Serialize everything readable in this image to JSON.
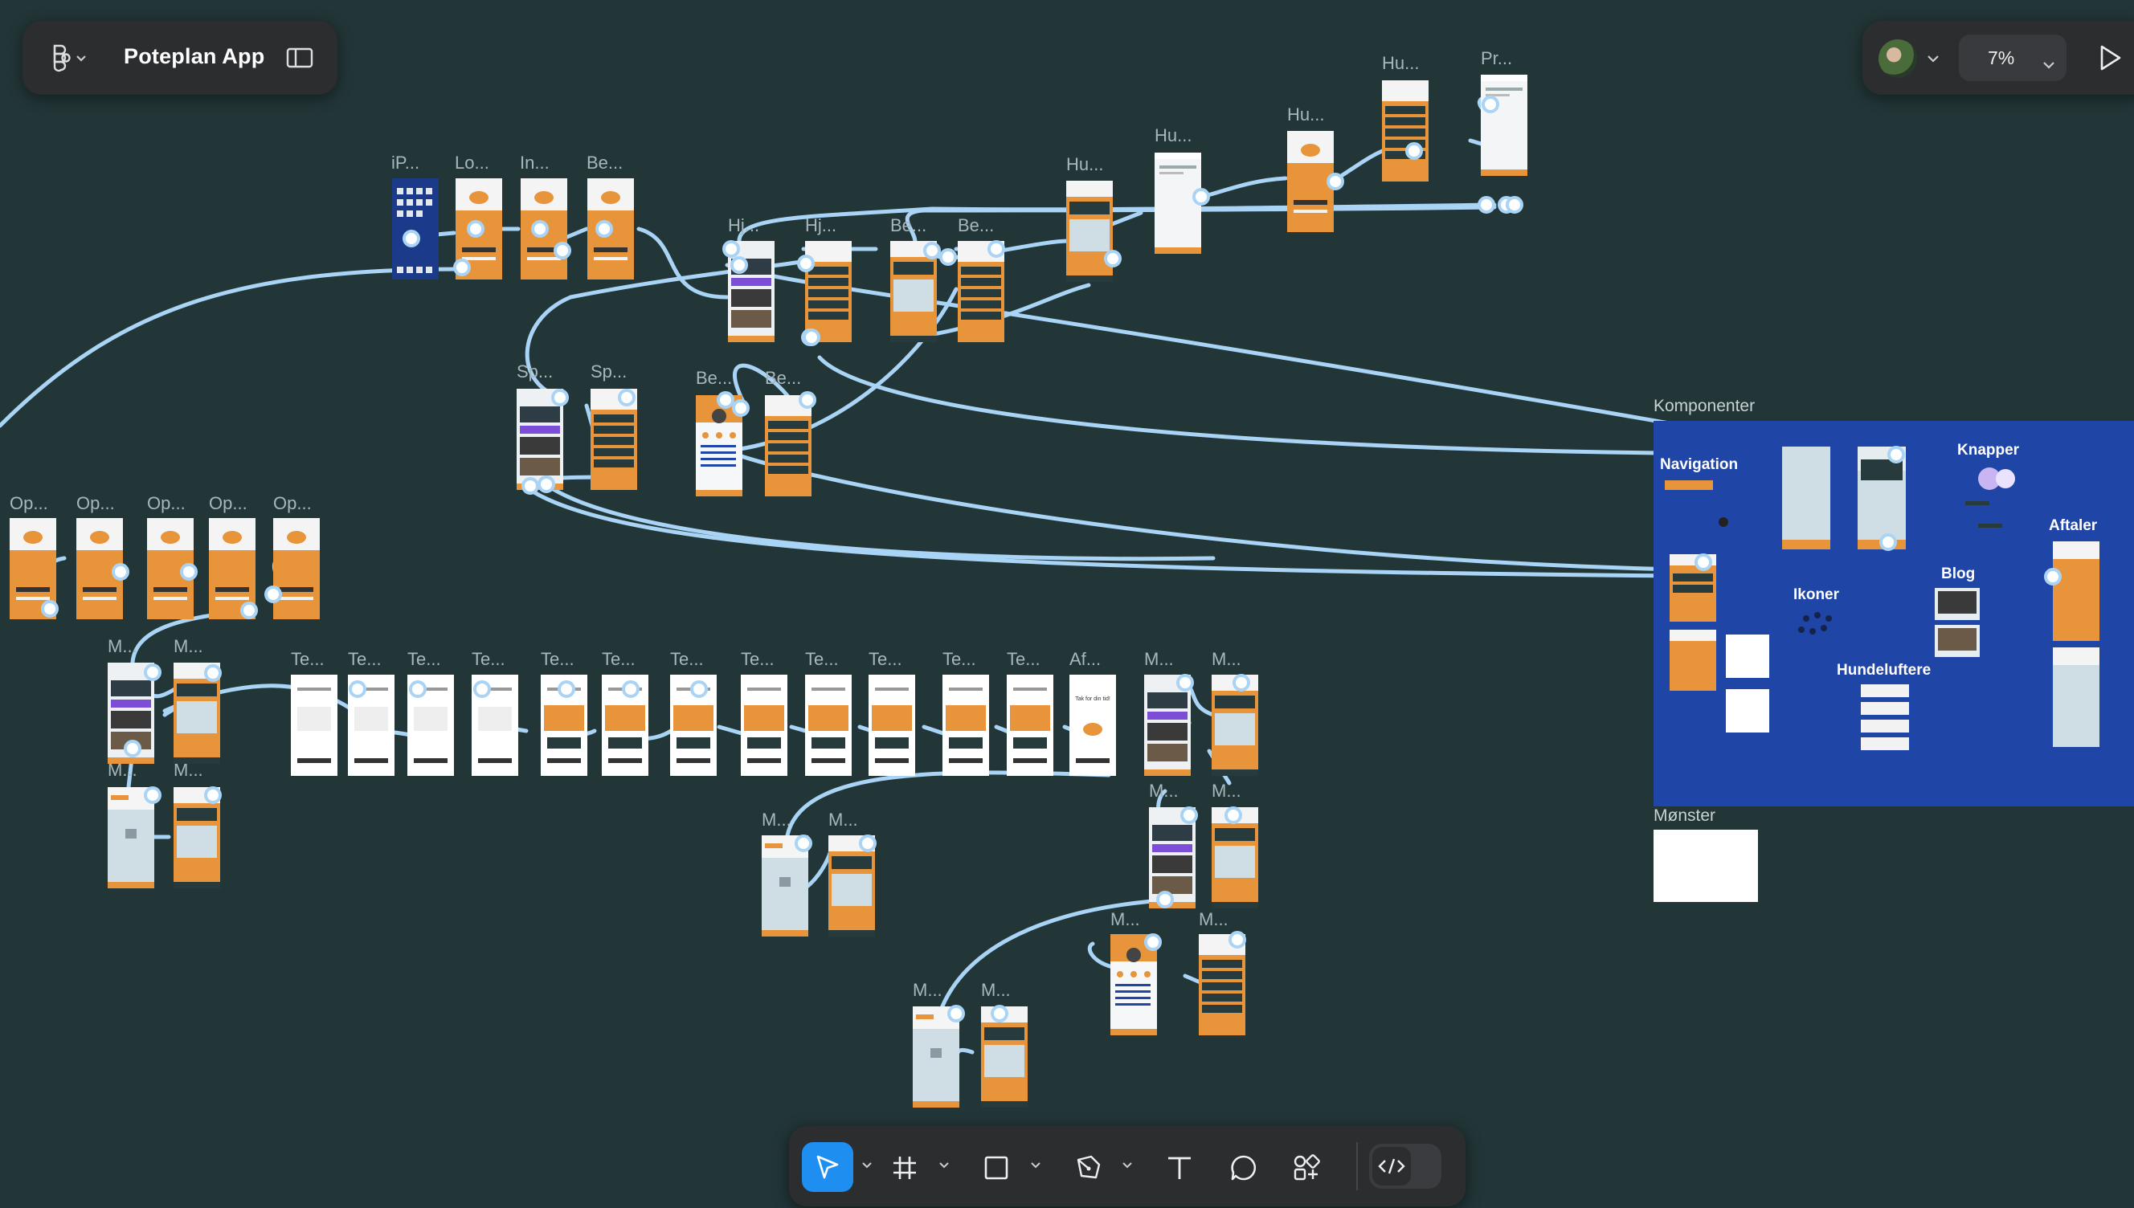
{
  "file": {
    "name": "Poteplan App"
  },
  "zoom": {
    "value": "7%"
  },
  "sections": {
    "komponenter": "Komponenter",
    "monster": "Mønster"
  },
  "components": {
    "navigation": "Navigation",
    "knapper": "Knapper",
    "aftaler": "Aftaler",
    "blog": "Blog",
    "ikoner": "Ikoner",
    "hundeluftere": "Hundeluftere"
  },
  "frame_labels": {
    "iphone": "iP...",
    "login": "Lo...",
    "intro": "In...",
    "be1": "Be...",
    "hj1": "Hj...",
    "hj2": "Hj...",
    "be2": "Be...",
    "be3": "Be...",
    "hu1": "Hu...",
    "hu2": "Hu...",
    "hu3": "Hu...",
    "hu4": "Hu...",
    "pr": "Pr...",
    "sp1": "Sp...",
    "sp2": "Sp...",
    "be4": "Be...",
    "be5": "Be...",
    "op1": "Op...",
    "op2": "Op...",
    "op3": "Op...",
    "op4": "Op...",
    "op5": "Op...",
    "m1": "M...",
    "m2": "M...",
    "m3": "M...",
    "m4": "M...",
    "te": "Te...",
    "af": "Af...",
    "m5": "M...",
    "m6": "M...",
    "m7": "M...",
    "m8": "M...",
    "m9": "M...",
    "m10": "M...",
    "m11": "M...",
    "m12": "M...",
    "m13": "M...",
    "m14": "M..."
  },
  "af_frame_text": "Tak for din tid!",
  "colors": {
    "canvas": "#223537",
    "orange": "#e8943a",
    "component_bg": "#1f45a6",
    "connector": "#a9d4f5",
    "accent": "#1e8ef0"
  },
  "toolbar": {
    "tools": [
      "move-tool",
      "frame-tool",
      "shape-tool",
      "pen-tool",
      "text-tool",
      "comment-tool",
      "actions-tool"
    ],
    "active": "move-tool",
    "dev_mode": "dev-mode-toggle"
  }
}
